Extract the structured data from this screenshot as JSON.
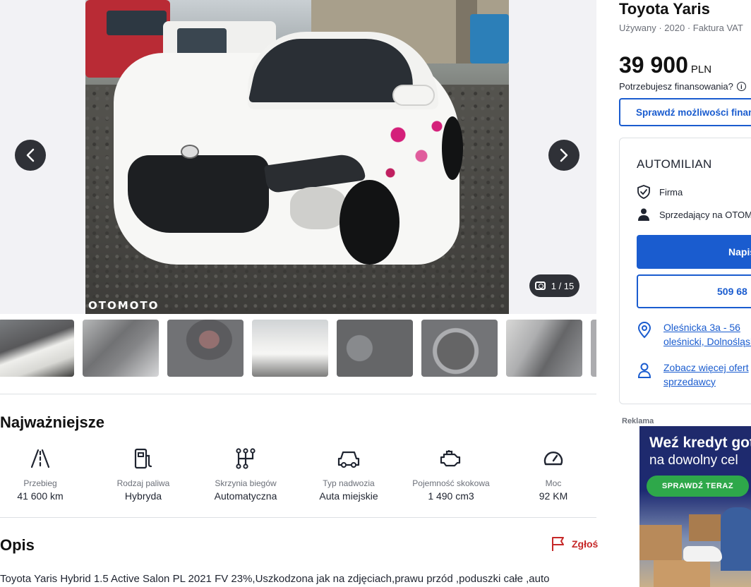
{
  "gallery": {
    "watermark": "OTOMOTO",
    "counter": "1 / 15",
    "prev_icon": "chevron-left-icon",
    "next_icon": "chevron-right-icon",
    "thumbnail_count_visible": 8
  },
  "highlights": {
    "title": "Najważniejsze",
    "items": [
      {
        "icon": "road-icon",
        "label": "Przebieg",
        "value": "41 600 km"
      },
      {
        "icon": "fuel-pump-icon",
        "label": "Rodzaj paliwa",
        "value": "Hybryda"
      },
      {
        "icon": "gearbox-icon",
        "label": "Skrzynia biegów",
        "value": "Automatyczna"
      },
      {
        "icon": "car-body-icon",
        "label": "Typ nadwozia",
        "value": "Auta miejskie"
      },
      {
        "icon": "engine-icon",
        "label": "Pojemność skokowa",
        "value": "1 490 cm3"
      },
      {
        "icon": "speedometer-icon",
        "label": "Moc",
        "value": "92 KM"
      }
    ]
  },
  "description": {
    "title": "Opis",
    "report_label": "Zgłoś",
    "text": "Toyota Yaris Hybrid 1.5 Active Salon PL 2021 FV 23%,Uszkodzona jak na zdjęciach,prawu przód ,poduszki całe ,auto"
  },
  "listing": {
    "title": "Toyota Yaris",
    "subtitle": "Używany · 2020 · Faktura VAT",
    "price": "39 900",
    "currency": "PLN",
    "finance_question": "Potrzebujesz finansowania?",
    "finance_button": "Sprawdź możliwości finansowania"
  },
  "seller": {
    "name": "AUTOMILIAN",
    "type": "Firma",
    "since": "Sprzedający na OTOMOTO",
    "message_button": "Napisz",
    "phone_button": "509 68",
    "address_line1": "Oleśnicka 3a - 56",
    "address_line2": "oleśnicki, Dolnośląskie",
    "more_offers_line1": "Zobacz więcej ofert",
    "more_offers_line2": "sprzedawcy"
  },
  "ad": {
    "label": "Reklama",
    "line1": "Weź kredyt gotówkowy",
    "line2": "na dowolny cel",
    "cta": "SPRAWDŹ TERAZ"
  },
  "colors": {
    "accent": "#1a5ccf",
    "report": "#c62828",
    "ad_cta": "#2ea84a"
  }
}
